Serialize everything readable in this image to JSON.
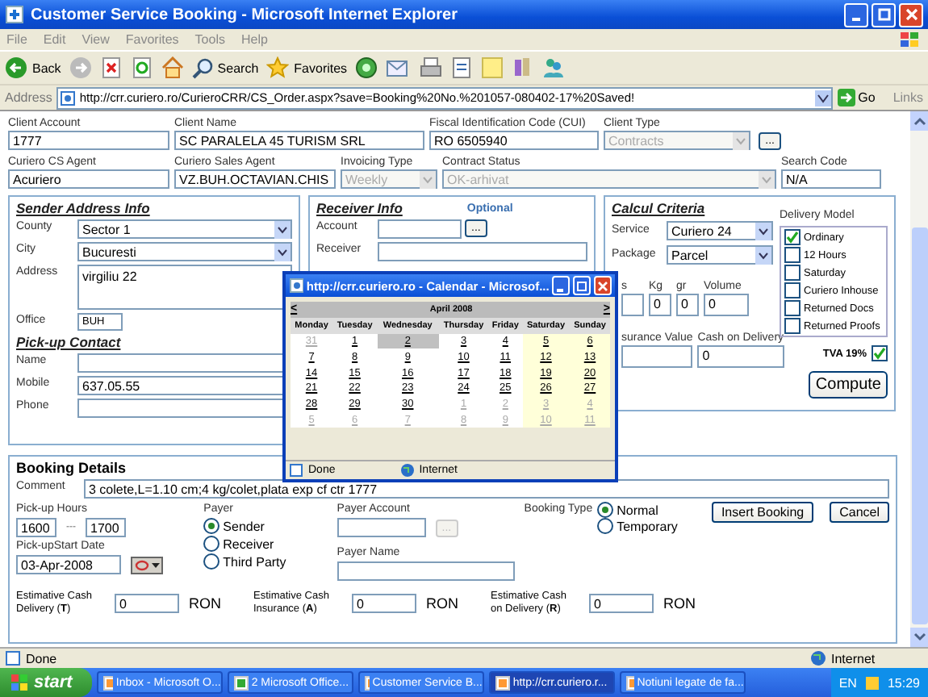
{
  "window": {
    "title": "Customer Service Booking - Microsoft Internet Explorer"
  },
  "menu": [
    "File",
    "Edit",
    "View",
    "Favorites",
    "Tools",
    "Help"
  ],
  "toolbar": {
    "back": "Back",
    "search": "Search",
    "favorites": "Favorites"
  },
  "address_bar": {
    "label": "Address",
    "url": "http://crr.curiero.ro/CurieroCRR/CS_Order.aspx?save=Booking%20No.%201057-080402-17%20Saved!",
    "go": "Go",
    "links": "Links"
  },
  "header_rows": [
    [
      {
        "label": "Client Account",
        "value": "1777",
        "kind": "text"
      },
      {
        "label": "Client Name",
        "value": "SC PARALELA 45 TURISM SRL",
        "kind": "text"
      },
      {
        "label": "Fiscal Identification Code (CUI)",
        "value": "RO 6505940",
        "kind": "text"
      },
      {
        "label": "Client Type",
        "value": "Contracts",
        "kind": "select",
        "disabled": true,
        "button": "..."
      }
    ],
    [
      {
        "label": "Curiero CS Agent",
        "value": "Acuriero",
        "kind": "text"
      },
      {
        "label": "Curiero Sales Agent",
        "value": "VZ.BUH.OCTAVIAN.CHIS",
        "kind": "text"
      },
      {
        "label": "Invoicing Type",
        "value": "Weekly",
        "kind": "select",
        "disabled": true
      },
      {
        "label": "Contract Status",
        "value": "OK-arhivat",
        "kind": "select",
        "disabled": true
      },
      {
        "label": "Search Code",
        "value": "N/A",
        "kind": "text"
      }
    ]
  ],
  "sender": {
    "title": "Sender Address Info",
    "fields": [
      {
        "label": "County",
        "value": "Sector 1",
        "kind": "select"
      },
      {
        "label": "City",
        "value": "Bucuresti",
        "kind": "select"
      },
      {
        "label": "Address",
        "value": "virgiliu 22",
        "kind": "textarea"
      },
      {
        "label": "Office",
        "value": "BUH",
        "kind": "small"
      }
    ],
    "contact_title": "Pick-up Contact",
    "contact_fields": [
      {
        "label": "Name"
      },
      {
        "label": "Mobile",
        "value": "637.05.55"
      },
      {
        "label": "Phone"
      }
    ]
  },
  "receiver": {
    "title": "Receiver Info",
    "note": "Optional",
    "account_label": "Account",
    "account_button": "...",
    "receiver_label": "Receiver"
  },
  "calcul": {
    "title": "Calcul Criteria",
    "service": {
      "label": "Service",
      "value": "Curiero 24"
    },
    "package": {
      "label": "Package",
      "value": "Parcel"
    },
    "weights": [
      {
        "label": "s"
      },
      {
        "label": "Kg",
        "value": "0"
      },
      {
        "label": "gr",
        "value": "0"
      },
      {
        "label": "Volume",
        "value": "0"
      }
    ],
    "insurance": {
      "label": "surance Value"
    },
    "cod": {
      "label": "Cash on Delivery",
      "value": "0"
    },
    "delivery_model": {
      "label": "Delivery Model",
      "options": [
        {
          "label": "Ordinary",
          "checked": true
        },
        {
          "label": "12 Hours",
          "checked": false
        },
        {
          "label": "Saturday",
          "checked": false
        },
        {
          "label": "Curiero Inhouse",
          "checked": false
        },
        {
          "label": "Returned Docs",
          "checked": false
        },
        {
          "label": "Returned Proofs",
          "checked": false
        }
      ]
    },
    "tva": {
      "label": "TVA 19%",
      "checked": true
    },
    "compute": "Compute"
  },
  "calendar": {
    "title": "http://crr.curiero.ro - Calendar - Microsof...",
    "prev": "<",
    "next": ">",
    "month": "April 2008",
    "days": [
      "Monday",
      "Tuesday",
      "Wednesday",
      "Thursday",
      "Friday",
      "Saturday",
      "Sunday"
    ],
    "weeks": [
      [
        {
          "day": "31",
          "other_month": true,
          "selected": false
        },
        {
          "day": "1",
          "other_month": false,
          "selected": false
        },
        {
          "day": "2",
          "other_month": false,
          "selected": true
        },
        {
          "day": "3",
          "other_month": false,
          "selected": false
        },
        {
          "day": "4",
          "other_month": false,
          "selected": false
        },
        {
          "day": "5",
          "other_month": false,
          "selected": false
        },
        {
          "day": "6",
          "other_month": false,
          "selected": false
        }
      ],
      [
        {
          "day": "7",
          "other_month": false,
          "selected": false
        },
        {
          "day": "8",
          "other_month": false,
          "selected": false
        },
        {
          "day": "9",
          "other_month": false,
          "selected": false
        },
        {
          "day": "10",
          "other_month": false,
          "selected": false
        },
        {
          "day": "11",
          "other_month": false,
          "selected": false
        },
        {
          "day": "12",
          "other_month": false,
          "selected": false
        },
        {
          "day": "13",
          "other_month": false,
          "selected": false
        }
      ],
      [
        {
          "day": "14",
          "other_month": false,
          "selected": false
        },
        {
          "day": "15",
          "other_month": false,
          "selected": false
        },
        {
          "day": "16",
          "other_month": false,
          "selected": false
        },
        {
          "day": "17",
          "other_month": false,
          "selected": false
        },
        {
          "day": "18",
          "other_month": false,
          "selected": false
        },
        {
          "day": "19",
          "other_month": false,
          "selected": false
        },
        {
          "day": "20",
          "other_month": false,
          "selected": false
        }
      ],
      [
        {
          "day": "21",
          "other_month": false,
          "selected": false
        },
        {
          "day": "22",
          "other_month": false,
          "selected": false
        },
        {
          "day": "23",
          "other_month": false,
          "selected": false
        },
        {
          "day": "24",
          "other_month": false,
          "selected": false
        },
        {
          "day": "25",
          "other_month": false,
          "selected": false
        },
        {
          "day": "26",
          "other_month": false,
          "selected": false
        },
        {
          "day": "27",
          "other_month": false,
          "selected": false
        }
      ],
      [
        {
          "day": "28",
          "other_month": false,
          "selected": false
        },
        {
          "day": "29",
          "other_month": false,
          "selected": false
        },
        {
          "day": "30",
          "other_month": false,
          "selected": false
        },
        {
          "day": "1",
          "other_month": true,
          "selected": false
        },
        {
          "day": "2",
          "other_month": true,
          "selected": false
        },
        {
          "day": "3",
          "other_month": true,
          "selected": false
        },
        {
          "day": "4",
          "other_month": true,
          "selected": false
        }
      ],
      [
        {
          "day": "5",
          "other_month": true,
          "selected": false
        },
        {
          "day": "6",
          "other_month": true,
          "selected": false
        },
        {
          "day": "7",
          "other_month": true,
          "selected": false
        },
        {
          "day": "8",
          "other_month": true,
          "selected": false
        },
        {
          "day": "9",
          "other_month": true,
          "selected": false
        },
        {
          "day": "10",
          "other_month": true,
          "selected": false
        },
        {
          "day": "11",
          "other_month": true,
          "selected": false
        }
      ]
    ],
    "status": "Done",
    "zone": "Internet"
  },
  "booking": {
    "title": "Booking Details",
    "comment_label": "Comment",
    "comment": "3 colete,L=1.10 cm;4 kg/colet,plata exp cf ctr 1777",
    "hours_label": "Pick-up Hours",
    "hour_from": "1600",
    "hour_sep": "---",
    "hour_to": "1700",
    "date_label": "Pick-upStart Date",
    "date": "03-Apr-2008",
    "payer_label": "Payer",
    "payers": [
      {
        "label": "Sender",
        "selected": true
      },
      {
        "label": "Receiver",
        "selected": false
      },
      {
        "label": "Third Party",
        "selected": false
      }
    ],
    "payer_account_label": "Payer Account",
    "payer_account_button": "...",
    "payer_name_label": "Payer Name",
    "booking_type_label": "Booking Type",
    "booking_types": [
      {
        "label": "Normal",
        "selected": true
      },
      {
        "label": "Temporary",
        "selected": false
      }
    ],
    "buttons": [
      "Insert Booking",
      "Cancel"
    ],
    "estimates": [
      {
        "label": "Estimative Cash Delivery (**T**)",
        "value": "0",
        "unit": "RON"
      },
      {
        "label": "Estimative Cash Insurance (**A**)",
        "value": "0",
        "unit": "RON"
      },
      {
        "label": "Estimative Cash on Delivery (**R**)",
        "value": "0",
        "unit": "RON"
      }
    ]
  },
  "status_bar": {
    "status": "Done",
    "zone": "Internet"
  },
  "taskbar": {
    "start": "start",
    "tasks": [
      {
        "label": "Inbox - Microsoft O...",
        "selected": false
      },
      {
        "label": "2 Microsoft Office...",
        "selected": false
      },
      {
        "label": "Customer Service B...",
        "selected": false
      },
      {
        "label": "http://crr.curiero.r...",
        "selected": true
      },
      {
        "label": "Notiuni legate de fa...",
        "selected": false
      }
    ],
    "language": "EN",
    "time": "15:29"
  }
}
